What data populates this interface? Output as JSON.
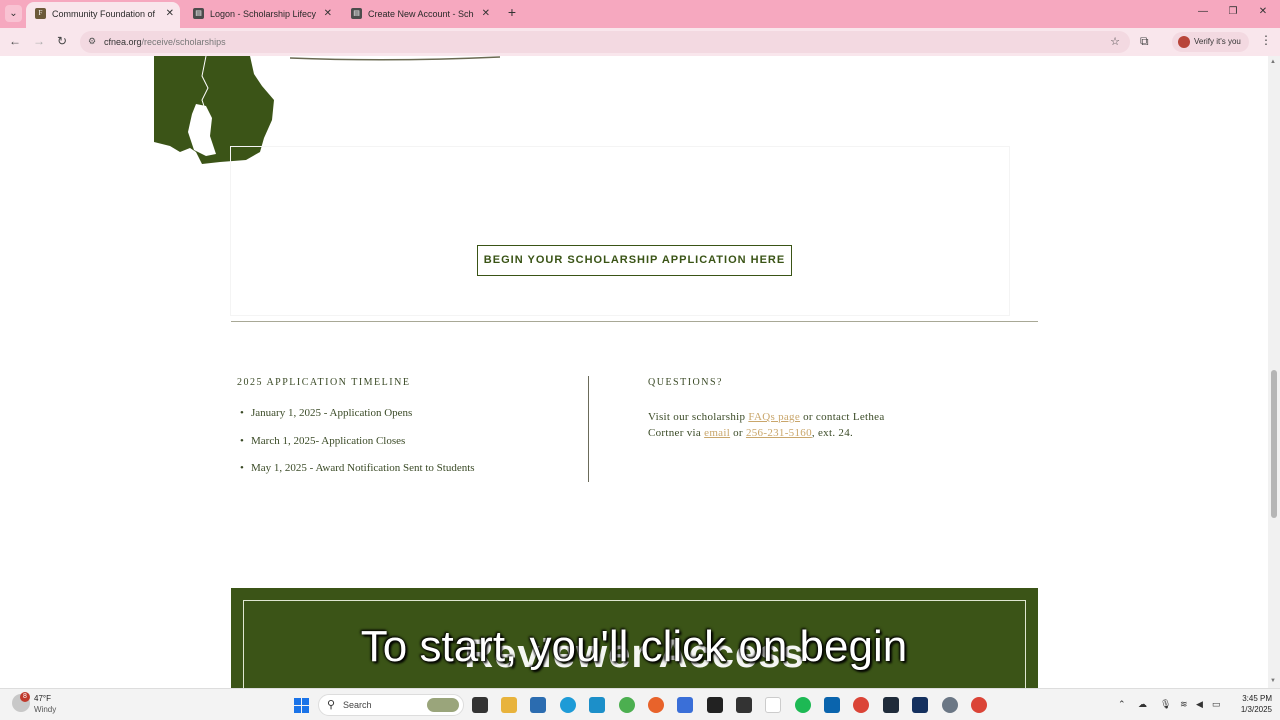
{
  "browser": {
    "tabs": [
      {
        "label": "Community Foundation of Nor",
        "active": true
      },
      {
        "label": "Logon - Scholarship Lifecycle M",
        "active": false
      },
      {
        "label": "Create New Account - Scholars",
        "active": false
      }
    ],
    "url_host": "cfnea.org",
    "url_path": "/receive/scholarships",
    "verify_label": "Verify it's you"
  },
  "page": {
    "begin_button": "BEGIN YOUR SCHOLARSHIP APPLICATION HERE",
    "timeline": {
      "heading": "2025 APPLICATION TIMELINE",
      "items": [
        "January 1, 2025 - Application Opens",
        "March 1, 2025- Application Closes",
        "May 1, 2025  - Award Notification Sent to Students"
      ]
    },
    "questions": {
      "heading": "QUESTIONS?",
      "text_1": "Visit our scholarship ",
      "faq_link": "FAQs page",
      "text_2": " or contact Lethea Cortner via ",
      "email_link": "email",
      "text_3": " or ",
      "phone_link": "256-231-5160",
      "text_4": ", ext. 24."
    },
    "band_title": "Reviewer Access",
    "caption": "To start, you'll click on begin"
  },
  "taskbar": {
    "weather_badge": "8",
    "weather_temp": "47°F",
    "weather_desc": "Windy",
    "search_label": "Search",
    "time": "3:45 PM",
    "date": "1/3/2025"
  },
  "colors": {
    "accent_green": "#3b5417",
    "link_gold": "#c9a66b",
    "tab_strip": "#f6a8bf"
  }
}
